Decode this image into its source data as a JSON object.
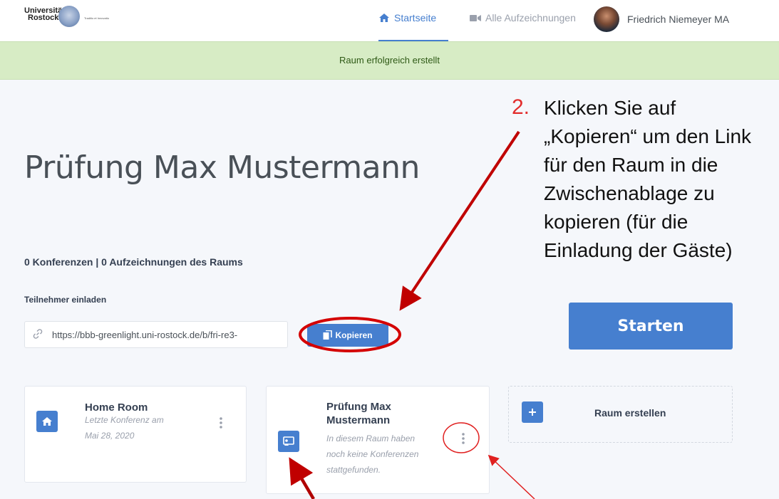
{
  "header": {
    "logo_line1": "Universität",
    "logo_line2": "Rostock",
    "logo_tagline": "Traditio et Innovatio",
    "nav_home": "Startseite",
    "nav_recordings": "Alle Aufzeichnungen",
    "user_name": "Friedrich Niemeyer MA"
  },
  "alert": {
    "message": "Raum erfolgreich erstellt"
  },
  "room": {
    "title": "Prüfung Max Mustermann",
    "stats": "0 Konferenzen | 0 Aufzeichnungen des Raums",
    "invite_label": "Teilnehmer einladen",
    "invite_link": "https://bbb-greenlight.uni-rostock.de/b/fri-re3-",
    "copy_label": "Kopieren",
    "start_label": "Starten"
  },
  "cards": [
    {
      "title": "Home Room",
      "subtitle_line1": "Letzte Konferenz am",
      "subtitle_line2": "Mai 28, 2020",
      "icon": "home-icon"
    },
    {
      "title_line1": "Prüfung Max",
      "title_line2": "Mustermann",
      "subtitle_line1": "In diesem Raum haben",
      "subtitle_line2": "noch keine Konferenzen",
      "subtitle_line3": "stattgefunden.",
      "icon": "presentation-icon"
    },
    {
      "title": "Raum erstellen",
      "icon": "plus-icon"
    }
  ],
  "annotation": {
    "number": "2.",
    "text_lines": [
      "Klicken Sie auf",
      "„Kopieren“ um den Link",
      "für den Raum in die",
      "Zwischenablage zu",
      "kopieren (für die",
      "Einladung der Gäste)"
    ]
  },
  "colors": {
    "primary": "#467fcf",
    "alert_bg": "#d7ecc5",
    "annotation_red": "#d40000"
  }
}
